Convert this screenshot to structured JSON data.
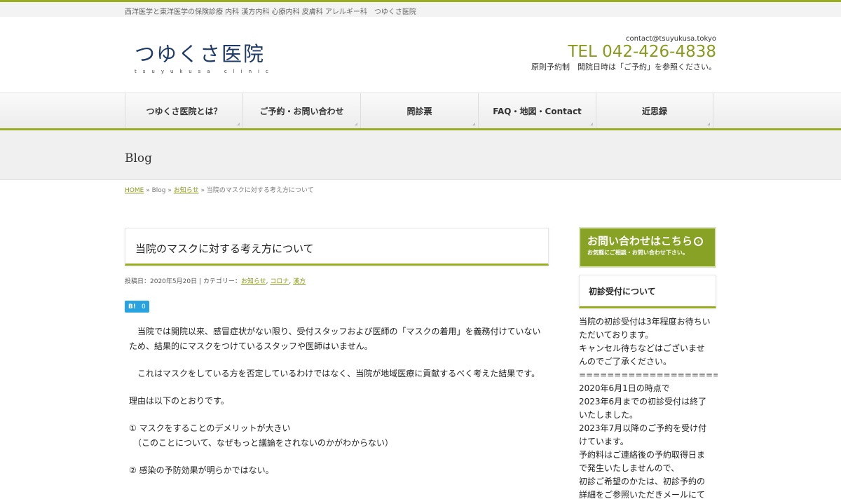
{
  "topbar": {
    "tagline": "西洋医学と東洋医学の保険診療 内科 漢方内科 心療内科 皮膚科 アレルギー科　つゆくさ医院"
  },
  "header": {
    "logo_ja": "つゆくさ医院",
    "logo_en": "tsuyukusa clinic",
    "email": "contact@tsuyukusa.tokyo",
    "tel": "TEL 042-426-4838",
    "note": "原則予約制　開院日時は「ご予約」を参照ください。"
  },
  "nav": {
    "items": [
      {
        "label": "つゆくさ医院とは？"
      },
      {
        "label": "ご予約・お問い合わせ"
      },
      {
        "label": "問診票"
      },
      {
        "label": "FAQ・地図・Contact"
      },
      {
        "label": "近思録"
      }
    ]
  },
  "page": {
    "heading": "Blog"
  },
  "breadcrumb": {
    "home": "HOME",
    "sep": "»",
    "blog": "Blog",
    "category": "お知らせ",
    "current": "当院のマスクに対する考え方について"
  },
  "post": {
    "title": "当院のマスクに対する考え方について",
    "meta_prefix": "投稿日：2020年5月20日 | カテゴリー：",
    "categories": [
      "お知らせ",
      "コロナ",
      "漢方"
    ],
    "hatena_label": "B!",
    "hatena_count": "0",
    "paragraphs": [
      "　当院では開院以来、感冒症状がない限り、受付スタッフおよび医師の「マスクの着用」を義務付けていないため、結果的にマスクをつけているスタッフや医師はいません。",
      "　これはマスクをしている方を否定しているわけではなく、当院が地域医療に貢献するべく考えた結果です。",
      "理由は以下のとおりです。",
      "① マスクをすることのデメリットが大きい",
      "　（このことについて、なぜもっと議論をされないのかがわからない）",
      "② 感染の予防効果が明らかではない。"
    ]
  },
  "sidebar": {
    "banner_big": "お問い合わせはこちら",
    "banner_arrow": "›",
    "banner_small": "お気軽にご相談・お問い合わせ下さい。",
    "widget_title": "初診受付について",
    "widget_lines": [
      "当院の初診受付は3年程度お待ちい",
      "ただいております。",
      "キャンセル待ちなどはございませ",
      "んのでご了承ください。",
      "========================",
      "2020年6月1日の時点で",
      "2023年6月までの初診受付は終了",
      "いたしました。",
      "2023年7月以降のご予約を受け付",
      "けています。",
      "予約料はご連絡後の予約取得日ま",
      "で発生いたしませんので、",
      "初診ご希望のかたは、初診予約の",
      "詳細をご参照いただきメールにて"
    ]
  },
  "colors": {
    "accent": "#9aad22",
    "link": "#8a9a1c",
    "logo": "#1f3b66",
    "hatena": "#29a3e0"
  }
}
